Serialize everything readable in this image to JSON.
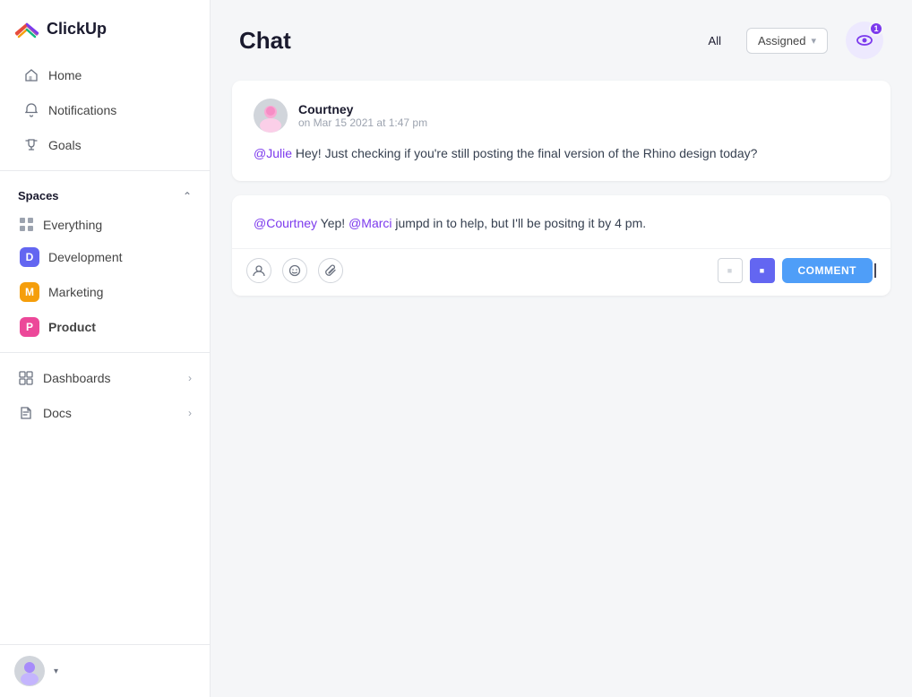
{
  "app": {
    "name": "ClickUp"
  },
  "sidebar": {
    "nav_items": [
      {
        "id": "home",
        "label": "Home",
        "icon": "home-icon"
      },
      {
        "id": "notifications",
        "label": "Notifications",
        "icon": "bell-icon"
      },
      {
        "id": "goals",
        "label": "Goals",
        "icon": "trophy-icon"
      }
    ],
    "spaces_label": "Spaces",
    "spaces": [
      {
        "id": "everything",
        "label": "Everything",
        "type": "grid"
      },
      {
        "id": "development",
        "label": "Development",
        "badge": "D",
        "color": "#6366f1"
      },
      {
        "id": "marketing",
        "label": "Marketing",
        "badge": "M",
        "color": "#f59e0b"
      },
      {
        "id": "product",
        "label": "Product",
        "badge": "P",
        "color": "#ec4899",
        "active": true
      }
    ],
    "bottom_items": [
      {
        "id": "dashboards",
        "label": "Dashboards"
      },
      {
        "id": "docs",
        "label": "Docs"
      }
    ]
  },
  "chat": {
    "title": "Chat",
    "filter_all": "All",
    "filter_assigned": "Assigned",
    "notification_badge": "1",
    "messages": [
      {
        "id": "msg1",
        "author": "Courtney",
        "time": "on Mar 15 2021 at 1:47 pm",
        "mention": "@Julie",
        "body": " Hey! Just checking if you're still posting the final version of the Rhino design today?"
      }
    ],
    "reply": {
      "mention1": "@Courtney",
      "text1": " Yep! ",
      "mention2": "@Marci",
      "text2": " jumpd in to help, but I'll be positng it by 4 pm."
    },
    "comment_button": "COMMENT",
    "format_btn1": "■",
    "format_btn2": "■"
  }
}
